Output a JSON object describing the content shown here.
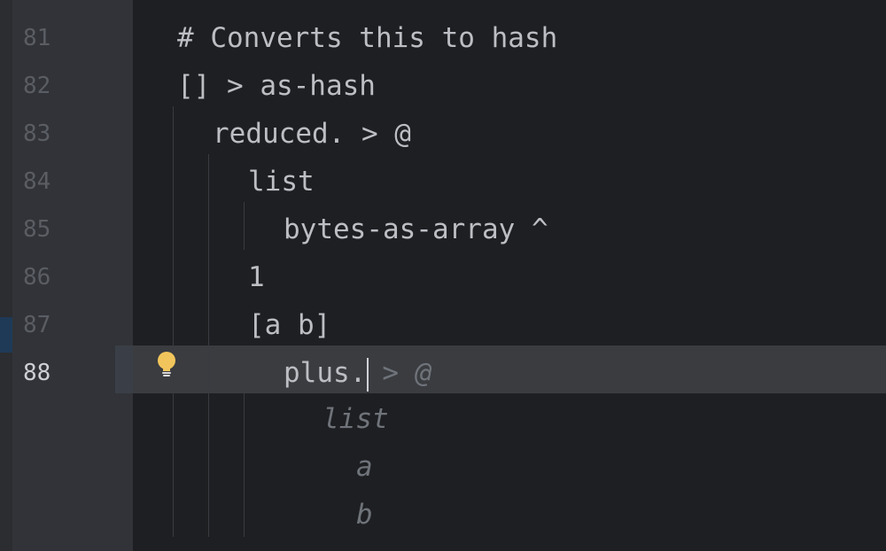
{
  "gutter": {
    "line_numbers": [
      "81",
      "82",
      "83",
      "84",
      "85",
      "86",
      "87",
      "88"
    ]
  },
  "code": {
    "lines": [
      "# Converts this to hash",
      "[] > as-hash",
      "reduced. > @",
      "list",
      "bytes-as-array ^",
      "1",
      "[a b]",
      "plus."
    ],
    "inline_hint": "> @",
    "completion_preview": [
      "list",
      "a",
      "b"
    ]
  },
  "icons": {
    "intention": "lightbulb-icon"
  },
  "colors": {
    "background": "#1e1f22",
    "gutter": "#313338",
    "text": "#bcbec4",
    "line_number": "#5a5d63",
    "current_line_number": "#ced0d6",
    "ghost_text": "#6f737a",
    "caret_row": "#3a3c40",
    "bulb": "#f2c55c"
  }
}
